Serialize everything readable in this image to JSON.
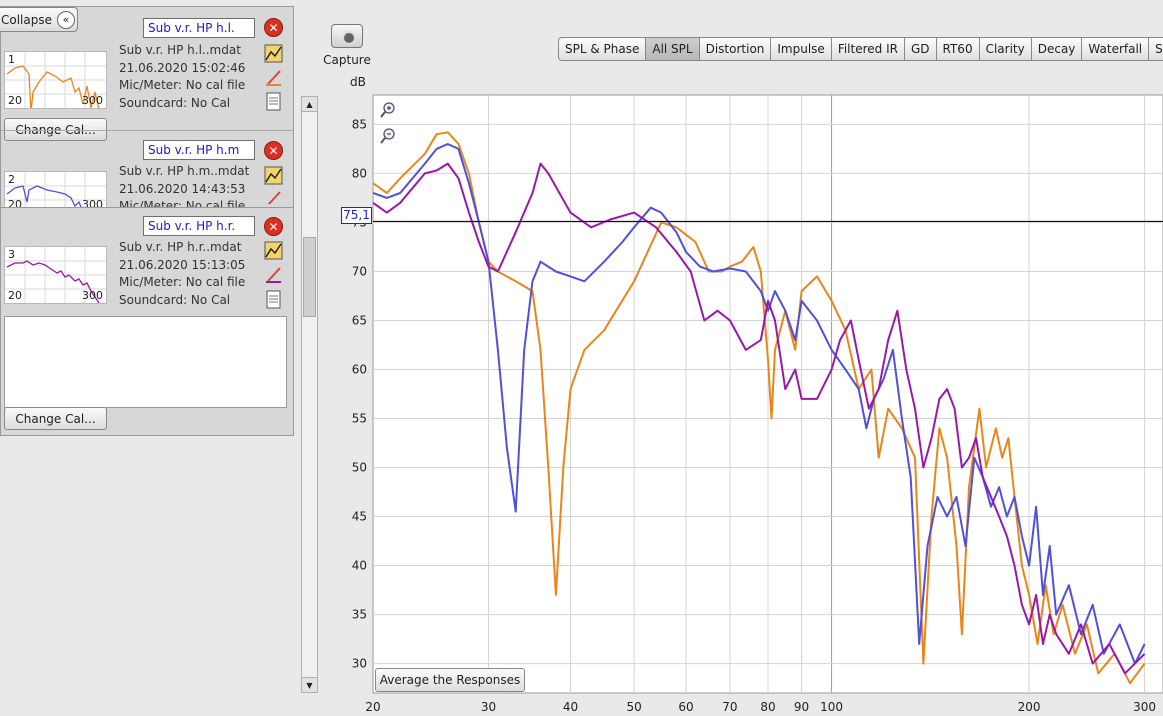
{
  "left_panel": {
    "collapse_label": "Collapse",
    "change_cal_label": "Change Cal...",
    "measurements": [
      {
        "num": "1",
        "name": "Sub v.r. HP h.l.",
        "file": "Sub v.r. HP h.l..mdat",
        "date": "21.06.2020 15:02:46",
        "mic": "Mic/Meter: No cal file",
        "soundcard": "Soundcard: No Cal",
        "color": "#e8861c"
      },
      {
        "num": "2",
        "name": "Sub v.r. HP h.m",
        "file": "Sub v.r. HP h.m..mdat",
        "date": "21.06.2020 14:43:53",
        "mic": "Mic/Meter: No cal file",
        "soundcard": "S",
        "color": "#5050d8"
      },
      {
        "num": "3",
        "name": "Sub v.r. HP h.r.",
        "file": "Sub v.r. HP h.r..mdat",
        "date": "21.06.2020 15:13:05",
        "mic": "Mic/Meter: No cal file",
        "soundcard": "Soundcard: No Cal",
        "color": "#9a18a8"
      }
    ],
    "thumb_x_min": "20",
    "thumb_x_max": "300"
  },
  "capture_label": "Capture",
  "tabs": [
    "SPL & Phase",
    "All SPL",
    "Distortion",
    "Impulse",
    "Filtered IR",
    "GD",
    "RT60",
    "Clarity",
    "Decay",
    "Waterfall",
    "Spectr"
  ],
  "active_tab": "All SPL",
  "average_button_label": "Average the Responses",
  "marker_value": "75,1",
  "chart_data": {
    "type": "line",
    "ylabel": "dB",
    "x_scale": "log",
    "xlim": [
      20,
      320
    ],
    "ylim": [
      27,
      88
    ],
    "y_ticks": [
      30,
      35,
      40,
      45,
      50,
      55,
      60,
      65,
      70,
      75,
      80,
      85
    ],
    "x_ticks": [
      20,
      30,
      40,
      50,
      60,
      70,
      80,
      90,
      100,
      200,
      300
    ],
    "reference_line": 75.1,
    "series": [
      {
        "name": "Sub v.r. HP h.l.",
        "color": "#e8861c",
        "points": [
          [
            20,
            79
          ],
          [
            21,
            78
          ],
          [
            22,
            79.5
          ],
          [
            24,
            82
          ],
          [
            25,
            84
          ],
          [
            26,
            84.2
          ],
          [
            27,
            83
          ],
          [
            28,
            80
          ],
          [
            29,
            75
          ],
          [
            30,
            71
          ],
          [
            31,
            70
          ],
          [
            33,
            69
          ],
          [
            35,
            68
          ],
          [
            36,
            62
          ],
          [
            37,
            50
          ],
          [
            38,
            37
          ],
          [
            39,
            50
          ],
          [
            40,
            58
          ],
          [
            42,
            62
          ],
          [
            45,
            64
          ],
          [
            50,
            69
          ],
          [
            55,
            75
          ],
          [
            58,
            74.5
          ],
          [
            62,
            73
          ],
          [
            65,
            70
          ],
          [
            68,
            70
          ],
          [
            70,
            70.5
          ],
          [
            73,
            71
          ],
          [
            76,
            72.5
          ],
          [
            78,
            70
          ],
          [
            80,
            61
          ],
          [
            81,
            55
          ],
          [
            82,
            62
          ],
          [
            85,
            66
          ],
          [
            88,
            62
          ],
          [
            90,
            68
          ],
          [
            95,
            69.5
          ],
          [
            100,
            67
          ],
          [
            105,
            64
          ],
          [
            110,
            58
          ],
          [
            115,
            60
          ],
          [
            118,
            51
          ],
          [
            122,
            56
          ],
          [
            128,
            54
          ],
          [
            134,
            51
          ],
          [
            138,
            30
          ],
          [
            142,
            45
          ],
          [
            146,
            54
          ],
          [
            150,
            51
          ],
          [
            155,
            42
          ],
          [
            158,
            33
          ],
          [
            162,
            48
          ],
          [
            168,
            56
          ],
          [
            172,
            50
          ],
          [
            178,
            54
          ],
          [
            182,
            51
          ],
          [
            186,
            53
          ],
          [
            190,
            47
          ],
          [
            195,
            40
          ],
          [
            200,
            37
          ],
          [
            206,
            32
          ],
          [
            212,
            38
          ],
          [
            218,
            33
          ],
          [
            225,
            36
          ],
          [
            235,
            31
          ],
          [
            245,
            34
          ],
          [
            255,
            29
          ],
          [
            270,
            31
          ],
          [
            285,
            28
          ],
          [
            300,
            30
          ]
        ]
      },
      {
        "name": "Sub v.r. HP h.m",
        "color": "#5050d8",
        "points": [
          [
            20,
            78
          ],
          [
            21,
            77.5
          ],
          [
            22,
            78
          ],
          [
            24,
            81
          ],
          [
            25,
            82.5
          ],
          [
            26,
            83
          ],
          [
            27,
            82.5
          ],
          [
            28,
            79
          ],
          [
            29,
            75
          ],
          [
            30,
            71
          ],
          [
            31,
            62
          ],
          [
            32,
            52
          ],
          [
            33,
            45.5
          ],
          [
            34,
            62
          ],
          [
            35,
            69
          ],
          [
            36,
            71
          ],
          [
            38,
            70
          ],
          [
            40,
            69.5
          ],
          [
            42,
            69
          ],
          [
            45,
            71
          ],
          [
            48,
            73
          ],
          [
            50,
            74.5
          ],
          [
            53,
            76.5
          ],
          [
            55,
            76
          ],
          [
            58,
            74
          ],
          [
            60,
            72
          ],
          [
            63,
            70.5
          ],
          [
            66,
            70
          ],
          [
            70,
            70.3
          ],
          [
            74,
            70
          ],
          [
            78,
            68
          ],
          [
            80,
            66
          ],
          [
            82,
            68
          ],
          [
            85,
            66
          ],
          [
            88,
            63
          ],
          [
            90,
            67
          ],
          [
            95,
            65
          ],
          [
            100,
            62
          ],
          [
            105,
            60
          ],
          [
            110,
            58
          ],
          [
            113,
            54
          ],
          [
            116,
            57
          ],
          [
            120,
            59
          ],
          [
            124,
            62
          ],
          [
            128,
            55
          ],
          [
            132,
            49
          ],
          [
            136,
            32
          ],
          [
            140,
            42
          ],
          [
            145,
            47
          ],
          [
            150,
            45
          ],
          [
            155,
            47
          ],
          [
            160,
            42
          ],
          [
            165,
            51
          ],
          [
            170,
            49
          ],
          [
            175,
            46
          ],
          [
            180,
            48
          ],
          [
            185,
            45
          ],
          [
            190,
            47
          ],
          [
            195,
            43
          ],
          [
            200,
            40
          ],
          [
            205,
            46
          ],
          [
            210,
            37
          ],
          [
            215,
            42
          ],
          [
            220,
            35
          ],
          [
            230,
            38
          ],
          [
            240,
            33
          ],
          [
            250,
            36
          ],
          [
            260,
            31
          ],
          [
            275,
            34
          ],
          [
            290,
            30
          ],
          [
            300,
            32
          ]
        ]
      },
      {
        "name": "Sub v.r. HP h.r.",
        "color": "#9a18a8",
        "points": [
          [
            20,
            77
          ],
          [
            21,
            76
          ],
          [
            22,
            77
          ],
          [
            24,
            80
          ],
          [
            25,
            80.3
          ],
          [
            26,
            81
          ],
          [
            27,
            79.5
          ],
          [
            28,
            76
          ],
          [
            29,
            73
          ],
          [
            30,
            70.5
          ],
          [
            31,
            70
          ],
          [
            33,
            74
          ],
          [
            35,
            78
          ],
          [
            36,
            81
          ],
          [
            37,
            80
          ],
          [
            40,
            76
          ],
          [
            43,
            74.5
          ],
          [
            46,
            75.3
          ],
          [
            50,
            76
          ],
          [
            54,
            74.5
          ],
          [
            58,
            72
          ],
          [
            61,
            70
          ],
          [
            64,
            65
          ],
          [
            67,
            66
          ],
          [
            70,
            65
          ],
          [
            74,
            62
          ],
          [
            78,
            63
          ],
          [
            80,
            67
          ],
          [
            82,
            65
          ],
          [
            85,
            58
          ],
          [
            88,
            60
          ],
          [
            90,
            57
          ],
          [
            95,
            57
          ],
          [
            100,
            60
          ],
          [
            103,
            63
          ],
          [
            107,
            65
          ],
          [
            110,
            61
          ],
          [
            114,
            56
          ],
          [
            118,
            58
          ],
          [
            122,
            63
          ],
          [
            126,
            66
          ],
          [
            130,
            60
          ],
          [
            134,
            56
          ],
          [
            138,
            50
          ],
          [
            142,
            53
          ],
          [
            146,
            57
          ],
          [
            150,
            58
          ],
          [
            154,
            56
          ],
          [
            158,
            50
          ],
          [
            162,
            51
          ],
          [
            166,
            53
          ],
          [
            170,
            49
          ],
          [
            175,
            47
          ],
          [
            180,
            45
          ],
          [
            185,
            43
          ],
          [
            190,
            40
          ],
          [
            195,
            36
          ],
          [
            200,
            34
          ],
          [
            205,
            37
          ],
          [
            210,
            32
          ],
          [
            215,
            35
          ],
          [
            220,
            33
          ],
          [
            230,
            31
          ],
          [
            240,
            34
          ],
          [
            250,
            30
          ],
          [
            265,
            32
          ],
          [
            280,
            29
          ],
          [
            300,
            31
          ]
        ]
      }
    ]
  }
}
